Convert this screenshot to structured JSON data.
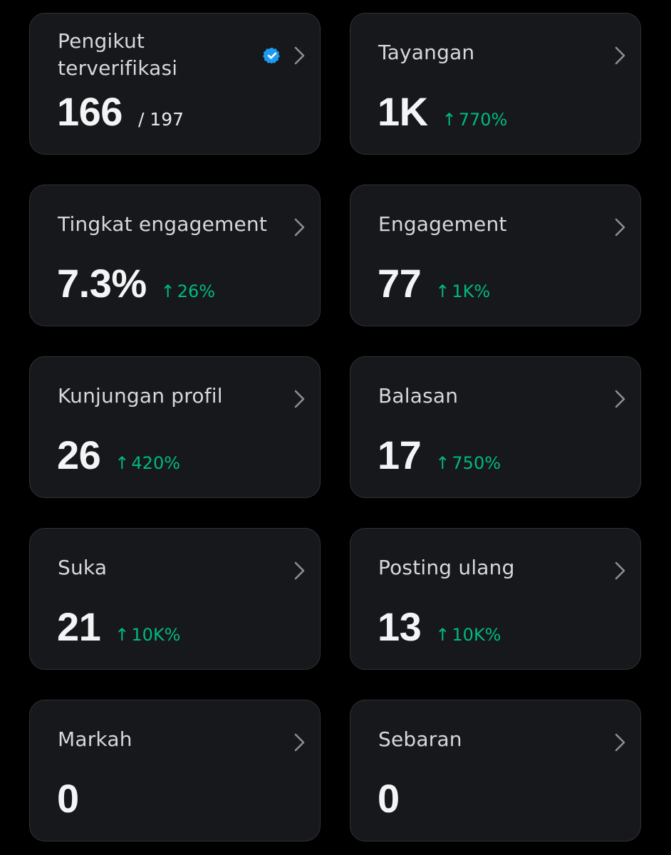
{
  "colors": {
    "background": "#000000",
    "card": "#16181c",
    "border": "#2f3336",
    "label": "#d6d9db",
    "value": "#f2f4f5",
    "positive": "#00ba7c",
    "verified": "#1d9bf0"
  },
  "cards": {
    "verified_followers": {
      "label": "Pengikut terverifikasi",
      "value": "166",
      "total": "/ 197",
      "icon": "verified-badge-icon"
    },
    "impressions": {
      "label": "Tayangan",
      "value": "1K",
      "change": "770%"
    },
    "engagement_rate": {
      "label": "Tingkat engagement",
      "value": "7.3%",
      "change": "26%"
    },
    "engagements": {
      "label": "Engagement",
      "value": "77",
      "change": "1K%"
    },
    "profile_visits": {
      "label": "Kunjungan profil",
      "value": "26",
      "change": "420%"
    },
    "replies": {
      "label": "Balasan",
      "value": "17",
      "change": "750%"
    },
    "likes": {
      "label": "Suka",
      "value": "21",
      "change": "10K%"
    },
    "reposts": {
      "label": "Posting ulang",
      "value": "13",
      "change": "10K%"
    },
    "bookmarks": {
      "label": "Markah",
      "value": "0"
    },
    "shares": {
      "label": "Sebaran",
      "value": "0"
    }
  },
  "icons": {
    "chevron": "chevron-right-icon",
    "up_arrow": "arrow-up-icon",
    "up_arrow_glyph": "↑"
  }
}
